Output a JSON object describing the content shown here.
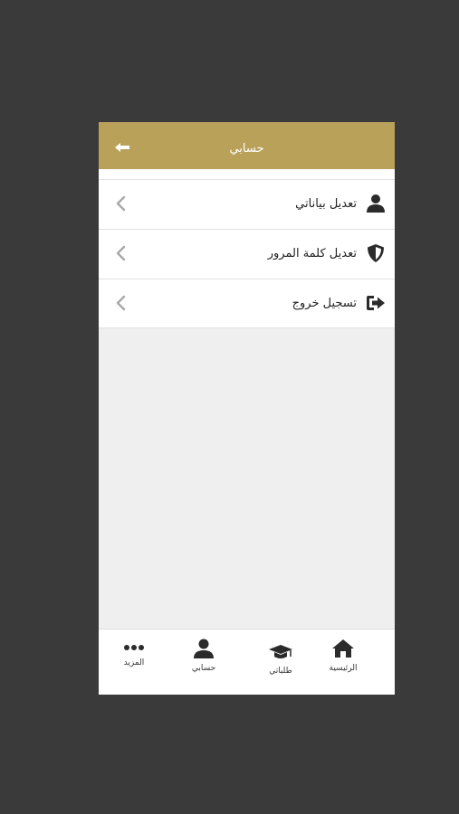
{
  "header": {
    "title": "حسابي",
    "back_icon": "arrow-left-icon"
  },
  "menu": {
    "items": [
      {
        "label": "تعديل بياناتي",
        "icon": "user-icon"
      },
      {
        "label": "تعديل كلمة المرور",
        "icon": "shield-icon"
      },
      {
        "label": "تسجيل خروج",
        "icon": "sign-out-icon"
      }
    ],
    "chevron_icon": "chevron-left-icon"
  },
  "tabbar": {
    "items": [
      {
        "label": "الرئيسية",
        "icon": "home-icon"
      },
      {
        "label": "طلباتي",
        "icon": "graduation-cap-icon"
      },
      {
        "label": "حسابي",
        "icon": "user-icon"
      },
      {
        "label": "المزيد",
        "icon": "more-dots-icon"
      }
    ]
  },
  "colors": {
    "header_bg": "#b9a15a",
    "page_bg": "#3a3a3a",
    "content_bg": "#f0eff0",
    "icon_dark": "#2b2b2b",
    "chevron": "#a8a8a8"
  }
}
